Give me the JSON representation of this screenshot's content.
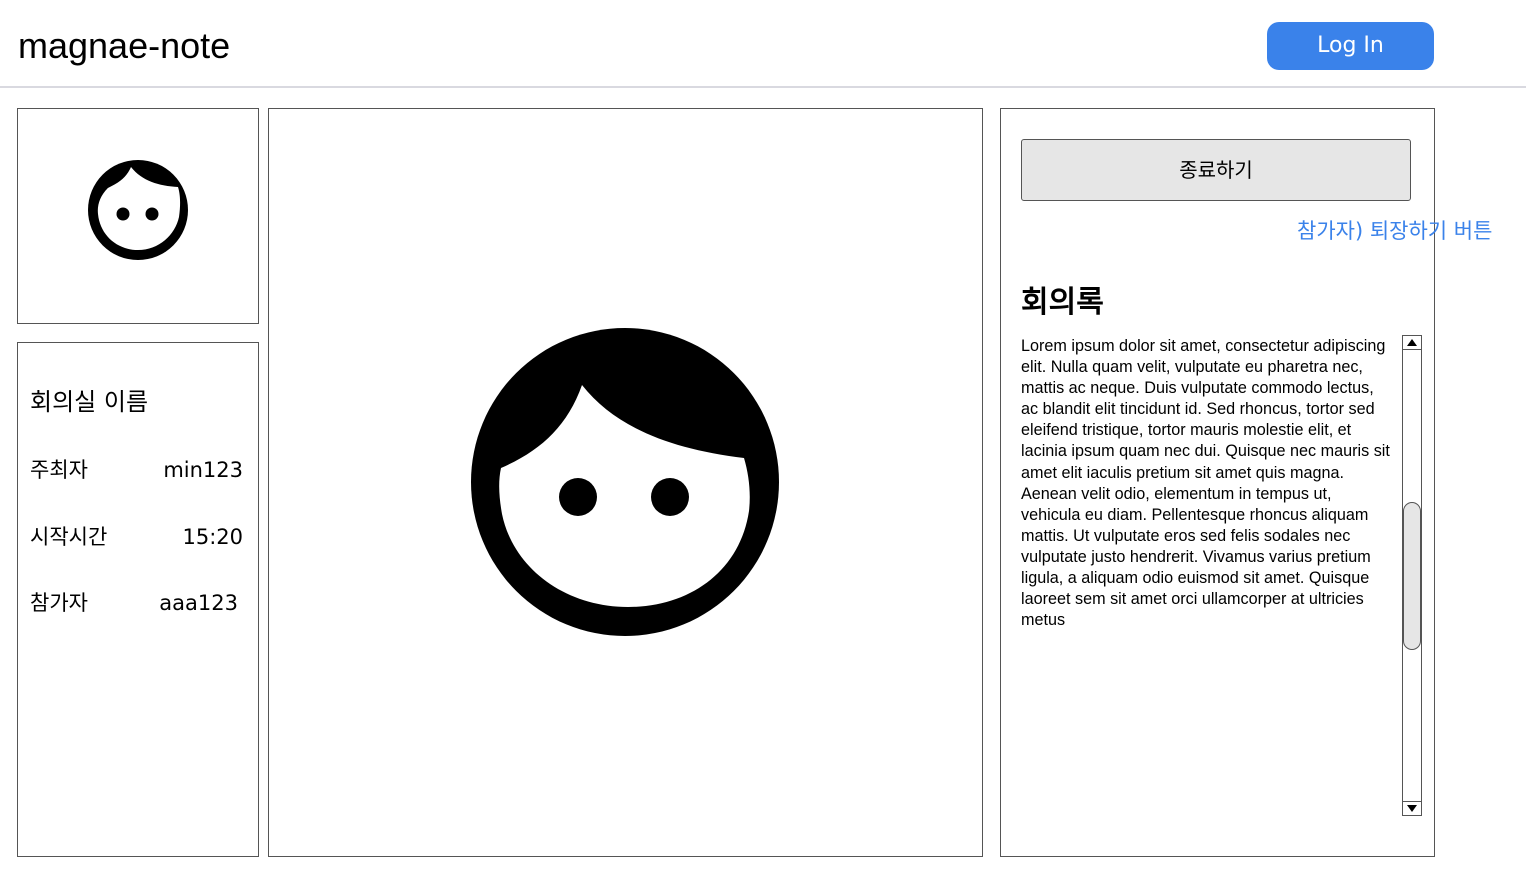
{
  "header": {
    "app_title": "magnae-note",
    "login_label": "Log In",
    "accent_color": "#3a82ea"
  },
  "participant_avatar": {
    "icon": "face-icon"
  },
  "room_info": {
    "room_name": "회의실 이름",
    "host_label": "주최자",
    "host_value": "min123",
    "start_label": "시작시간",
    "start_value": "15:20",
    "participant_label": "참가자",
    "participant_value": "aaa123"
  },
  "main_video": {
    "icon": "face-icon"
  },
  "notes": {
    "end_button_label": "종료하기",
    "leave_annotation": "참가자) 퇴장하기 버튼",
    "title": "회의록",
    "body": "Lorem ipsum dolor sit amet, consectetur adipiscing elit. Nulla quam velit, vulputate eu pharetra nec, mattis ac neque. Duis vulputate commodo lectus, ac blandit elit tincidunt id. Sed rhoncus, tortor sed eleifend tristique, tortor mauris molestie elit, et lacinia ipsum quam nec dui. Quisque nec mauris sit amet elit iaculis pretium sit amet quis magna. Aenean velit odio, elementum in tempus ut, vehicula eu diam. Pellentesque rhoncus aliquam mattis. Ut vulputate eros sed felis sodales nec vulputate justo hendrerit. Vivamus varius pretium ligula, a aliquam odio euismod sit amet. Quisque laoreet sem sit amet orci ullamcorper at ultricies metus"
  }
}
